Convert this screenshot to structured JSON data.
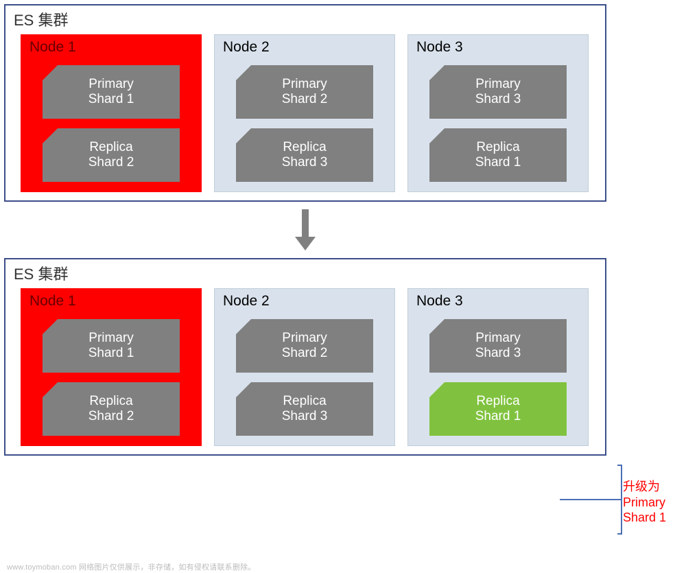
{
  "top": {
    "title": "ES 集群",
    "nodes": [
      {
        "label": "Node 1",
        "red": true,
        "shards": [
          {
            "l1": "Primary",
            "l2": "Shard 1",
            "green": false
          },
          {
            "l1": "Replica",
            "l2": "Shard 2",
            "green": false
          }
        ]
      },
      {
        "label": "Node 2",
        "red": false,
        "shards": [
          {
            "l1": "Primary",
            "l2": "Shard 2",
            "green": false
          },
          {
            "l1": "Replica",
            "l2": "Shard 3",
            "green": false
          }
        ]
      },
      {
        "label": "Node 3",
        "red": false,
        "shards": [
          {
            "l1": "Primary",
            "l2": "Shard 3",
            "green": false
          },
          {
            "l1": "Replica",
            "l2": "Shard 1",
            "green": false
          }
        ]
      }
    ]
  },
  "bottom": {
    "title": "ES 集群",
    "nodes": [
      {
        "label": "Node 1",
        "red": true,
        "shards": [
          {
            "l1": "Primary",
            "l2": "Shard 1",
            "green": false
          },
          {
            "l1": "Replica",
            "l2": "Shard 2",
            "green": false
          }
        ]
      },
      {
        "label": "Node 2",
        "red": false,
        "shards": [
          {
            "l1": "Primary",
            "l2": "Shard 2",
            "green": false
          },
          {
            "l1": "Replica",
            "l2": "Shard 3",
            "green": false
          }
        ]
      },
      {
        "label": "Node 3",
        "red": false,
        "shards": [
          {
            "l1": "Primary",
            "l2": "Shard 3",
            "green": false
          },
          {
            "l1": "Replica",
            "l2": "Shard 1",
            "green": true
          }
        ]
      }
    ]
  },
  "callout": {
    "l1": "升级为",
    "l2": "Primary",
    "l3": "Shard 1"
  },
  "watermark": "www.toymoban.com 网络图片仅供展示，非存储，如有侵权请联系删除。"
}
